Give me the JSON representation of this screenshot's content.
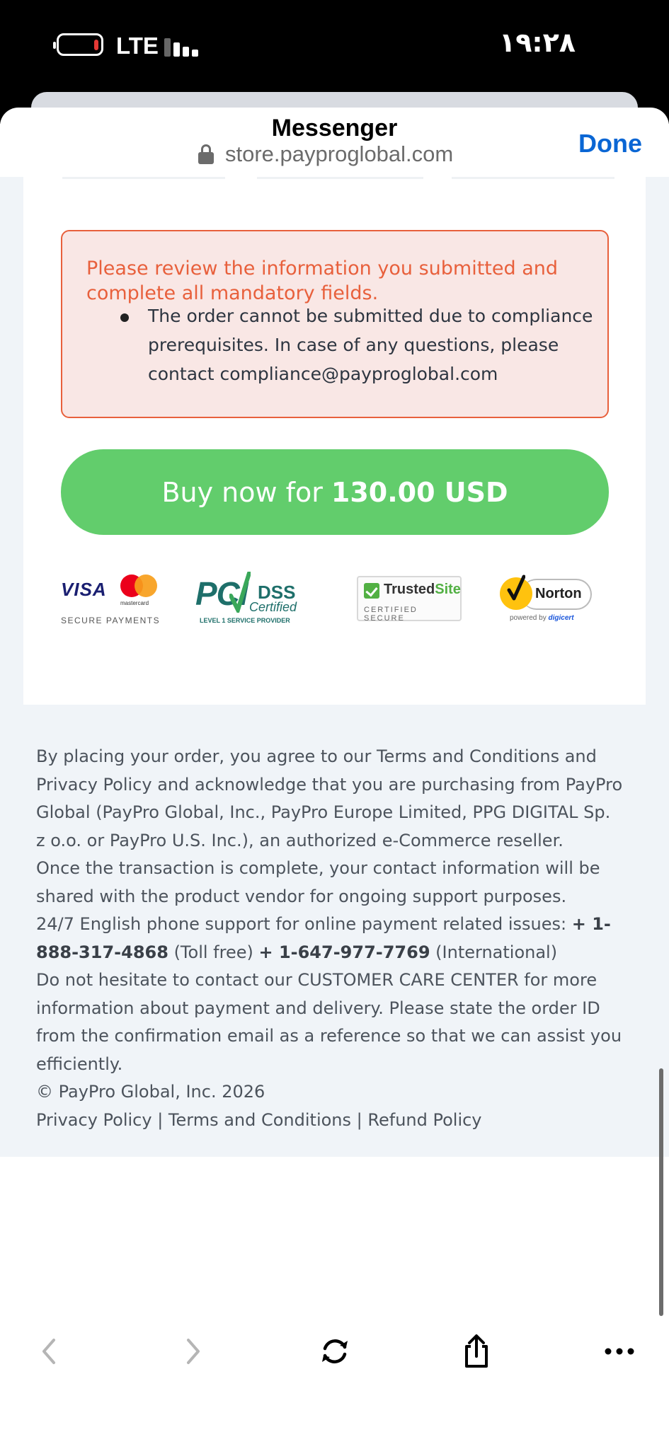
{
  "status_bar": {
    "network": "LTE",
    "time": "١٩:٢٨"
  },
  "browser": {
    "title": "Messenger",
    "url": "store.payproglobal.com",
    "done_label": "Done"
  },
  "alert": {
    "title": "Please review the information you submitted and complete all mandatory fields.",
    "message": "The order cannot be submitted due to compliance prerequisites. In case of any questions, please contact compliance@payproglobal.com"
  },
  "buy_button": {
    "prefix": "Buy now for",
    "amount": "130.00 USD"
  },
  "badges": {
    "visa": "VISA",
    "mastercard": "mastercard",
    "secure_payments": "SECURE PAYMENTS",
    "pci_word": "PCI",
    "pci_dss": "DSS",
    "pci_certified": "Certified",
    "pci_level": "LEVEL 1 SERVICE PROVIDER",
    "trusted_site_a": "Trusted",
    "trusted_site_b": "Site",
    "certified_secure": "CERTIFIED SECURE",
    "norton": "Norton",
    "powered_by": "powered by",
    "digicert": "digicert"
  },
  "footer": {
    "agreement": "By placing your order, you agree to our Terms and Conditions and Privacy Policy and acknowledge that you are purchasing from PayPro Global (PayPro Global, Inc., PayPro Europe Limited, PPG DIGITAL Sp. z o.o. or PayPro U.S. Inc.), an authorized e-Commerce reseller.",
    "contact_sharing": "Once the transaction is complete, your contact information will be shared with the product vendor for ongoing support purposes.",
    "phone_intro": "24/7 English phone support for online payment related issues:",
    "phone_tollfree": "+ 1-888-317-4868",
    "tollfree_label": "(Toll free)",
    "phone_international": "+ 1-647-977-7769",
    "international_label": "(International)",
    "care_center": "Do not hesitate to contact our CUSTOMER CARE CENTER for more information about payment and delivery. Please state the order ID from the confirmation email as a reference so that we can assist you efficiently.",
    "copyright": "© PayPro Global, Inc. 2026",
    "links": {
      "privacy": "Privacy Policy",
      "terms": "Terms and Conditions",
      "refund": "Refund Policy",
      "separator": " | "
    }
  },
  "toolbar": {
    "icons": [
      "back-icon",
      "forward-icon",
      "reload-icon",
      "share-icon",
      "more-icon"
    ]
  }
}
